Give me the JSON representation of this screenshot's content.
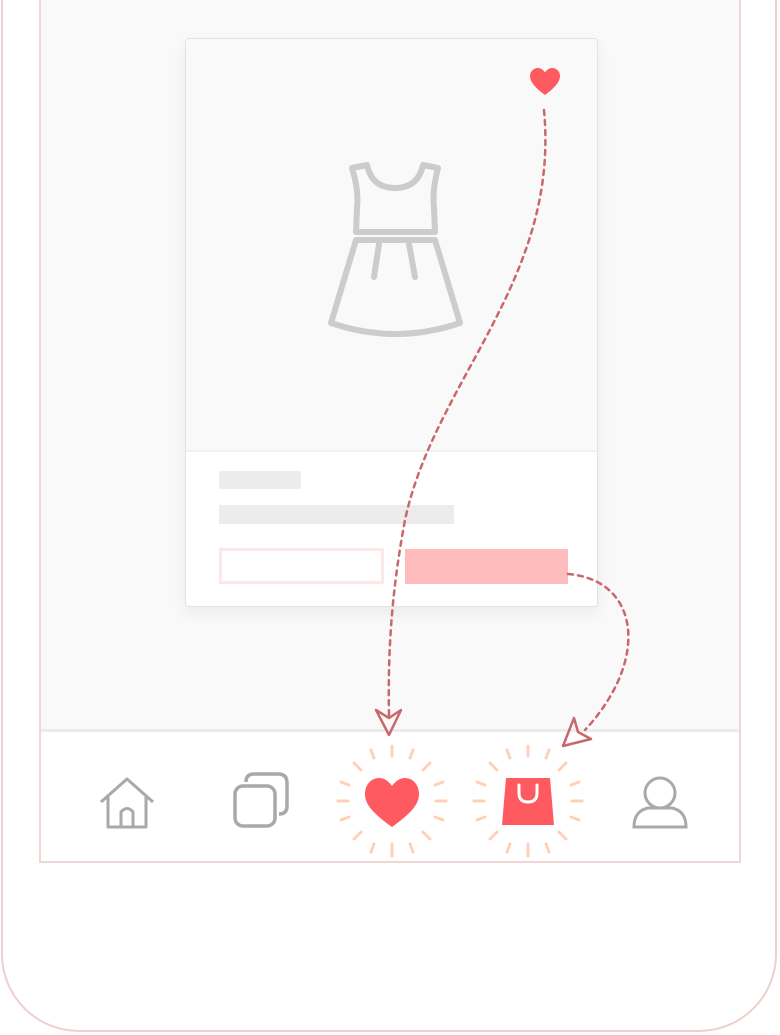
{
  "colors": {
    "accent": "#ff5a5f",
    "icon_gray": "#a9a9a9",
    "arrow": "#c9686c",
    "burst": "#ffd0b8",
    "primary_button": "#ffbcbd",
    "frame": "#efcfcf"
  },
  "product_card": {
    "image_icon": "dress-icon",
    "favorite_icon": "heart-icon"
  },
  "tab_bar": {
    "items": [
      {
        "name": "home",
        "icon": "home-icon",
        "active": false
      },
      {
        "name": "collections",
        "icon": "stacked-squares-icon",
        "active": false
      },
      {
        "name": "favorites",
        "icon": "heart-icon",
        "active": true
      },
      {
        "name": "bag",
        "icon": "shopping-bag-icon",
        "active": true
      },
      {
        "name": "profile",
        "icon": "user-icon",
        "active": false
      }
    ]
  }
}
